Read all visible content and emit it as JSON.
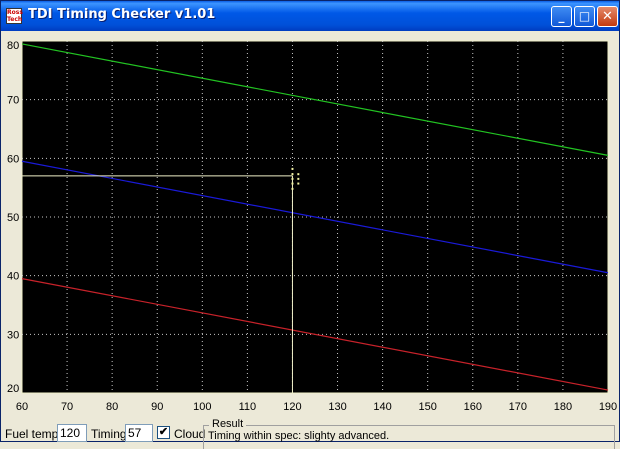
{
  "window": {
    "title": "TDI Timing Checker v1.01",
    "app_icon_text": "Ross Tech",
    "buttons": {
      "minimize": "_",
      "maximize": "□",
      "close": "✕"
    }
  },
  "chart_data": {
    "type": "line",
    "x": [
      60,
      190
    ],
    "xlim": [
      60,
      190
    ],
    "ylim": [
      20,
      80
    ],
    "xticks": [
      "60",
      "70",
      "80",
      "90",
      "100",
      "110",
      "120",
      "130",
      "140",
      "150",
      "160",
      "170",
      "180",
      "190"
    ],
    "yticks": [
      "20",
      "30",
      "40",
      "50",
      "60",
      "70",
      "80"
    ],
    "grid": true,
    "series": [
      {
        "color": "#22c322",
        "x": [
          60,
          190
        ],
        "values": [
          79.5,
          60.5
        ]
      },
      {
        "color": "#1a1ad8",
        "x": [
          60,
          190
        ],
        "values": [
          59.5,
          40.5
        ]
      },
      {
        "color": "#c8222a",
        "x": [
          60,
          190
        ],
        "values": [
          39.5,
          20.5
        ]
      }
    ],
    "marker": {
      "color": "#f0f0c8",
      "x": 120,
      "y": 57
    },
    "cloud": {
      "color": "#f0f0a0",
      "points": [
        [
          120,
          58.2
        ],
        [
          120,
          57.3
        ],
        [
          120,
          56.5
        ],
        [
          120,
          55.7
        ],
        [
          120,
          54.8
        ],
        [
          121.3,
          57.3
        ],
        [
          121.3,
          56.5
        ],
        [
          121.3,
          55.7
        ]
      ]
    }
  },
  "controls": {
    "fuel_temp_label": "Fuel temp",
    "fuel_temp_value": "120",
    "timing_label": "Timing",
    "timing_value": "57",
    "cloud_label": "Cloud",
    "cloud_checked": true,
    "cloud_check_glyph": "✔"
  },
  "result": {
    "legend": "Result",
    "text": "Timing within spec: slighty advanced."
  }
}
